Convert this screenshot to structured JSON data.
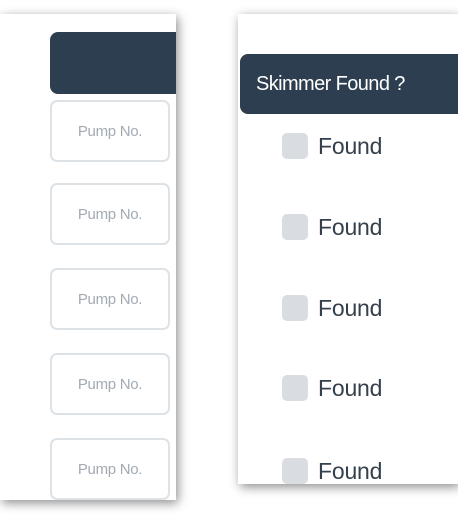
{
  "left_table": {
    "header_label": "",
    "pump_inputs": [
      {
        "placeholder": "Pump No."
      },
      {
        "placeholder": "Pump No."
      },
      {
        "placeholder": "Pump No."
      },
      {
        "placeholder": "Pump No."
      },
      {
        "placeholder": "Pump No."
      }
    ]
  },
  "right_table": {
    "header_label": "Skimmer Found ?",
    "rows": [
      {
        "label": "Found",
        "checked": false
      },
      {
        "label": "Found",
        "checked": false
      },
      {
        "label": "Found",
        "checked": false
      },
      {
        "label": "Found",
        "checked": false
      },
      {
        "label": "Found",
        "checked": false
      }
    ]
  },
  "colors": {
    "header_bg": "#2c3e50",
    "input_border": "#dde2e7",
    "placeholder_text": "#a2aab3",
    "checkbox_bg": "#d9dde1",
    "label_text": "#34404c"
  }
}
